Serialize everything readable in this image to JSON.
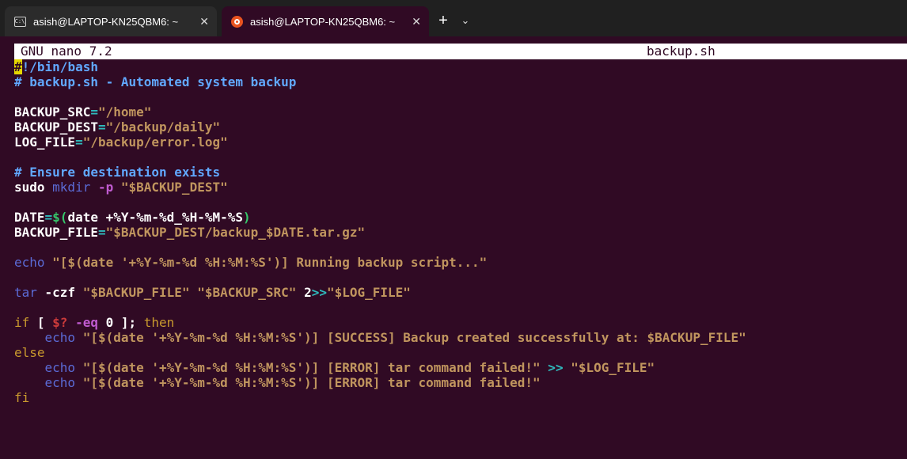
{
  "tabs": [
    {
      "title": "asish@LAPTOP-KN25QBM6: ~",
      "icon": "cmd-icon"
    },
    {
      "title": "asish@LAPTOP-KN25QBM6: ~",
      "icon": "ubuntu-icon"
    }
  ],
  "new_tab_label": "+",
  "dropdown_label": "⌄",
  "close_label": "✕",
  "nano": {
    "version": "GNU nano 7.2",
    "filename": "backup.sh"
  },
  "lines": [
    {
      "t": "cursor",
      "a": "#",
      "b": "!/bin/bash"
    },
    {
      "t": "comment",
      "a": "# backup.sh - Automated system backup"
    },
    {
      "t": "blank"
    },
    {
      "t": "assign",
      "name": "BACKUP_SRC",
      "eq": "=",
      "val": "\"/home\""
    },
    {
      "t": "assign",
      "name": "BACKUP_DEST",
      "eq": "=",
      "val": "\"/backup/daily\""
    },
    {
      "t": "assign",
      "name": "LOG_FILE",
      "eq": "=",
      "val": "\"/backup/error.log\""
    },
    {
      "t": "blank"
    },
    {
      "t": "comment",
      "a": "# Ensure destination exists"
    },
    {
      "t": "sudo",
      "a": "sudo",
      "b": " mkdir",
      "c": " -p",
      "d": " \"$BACKUP_DEST\""
    },
    {
      "t": "blank"
    },
    {
      "t": "date",
      "name": "DATE",
      "eq": "=",
      "d1": "$(",
      "v": "date +%Y-%m-%d_%H-%M-%S",
      "d2": ")"
    },
    {
      "t": "assign2",
      "name": "BACKUP_FILE",
      "eq": "=",
      "q1": "\"",
      "v": "$BACKUP_DEST/backup_$DATE.tar.gz",
      "q2": "\""
    },
    {
      "t": "blank"
    },
    {
      "t": "echo1",
      "kw": "echo",
      "s": " \"[$(date '+%Y-%m-%d %H:%M:%S')] Running backup script...\""
    },
    {
      "t": "blank"
    },
    {
      "t": "tar",
      "kw": "tar",
      "f": " -czf",
      "s1": " \"$BACKUP_FILE\"",
      "s2": " \"$BACKUP_SRC\"",
      "r": " 2",
      "op": ">>",
      "s3": "\"$LOG_FILE\""
    },
    {
      "t": "blank"
    },
    {
      "t": "if",
      "a": "if",
      "b": " [ ",
      "c": "$?",
      "d": " -eq ",
      "e": "0",
      "f": " ]; ",
      "g": "then"
    },
    {
      "t": "echo2",
      "ind": "    ",
      "kw": "echo",
      "s": " \"[$(date '+%Y-%m-%d %H:%M:%S')] [SUCCESS] Backup created successfully at: $BACKUP_FILE\""
    },
    {
      "t": "kw",
      "a": "else"
    },
    {
      "t": "echo3",
      "ind": "    ",
      "kw": "echo",
      "s": " \"[$(date '+%Y-%m-%d %H:%M:%S')] [ERROR] tar command failed!\"",
      "op": " >>",
      "s2": " \"$LOG_FILE\""
    },
    {
      "t": "echo2",
      "ind": "    ",
      "kw": "echo",
      "s": " \"[$(date '+%Y-%m-%d %H:%M:%S')] [ERROR] tar command failed!\""
    },
    {
      "t": "kw",
      "a": "fi"
    }
  ]
}
